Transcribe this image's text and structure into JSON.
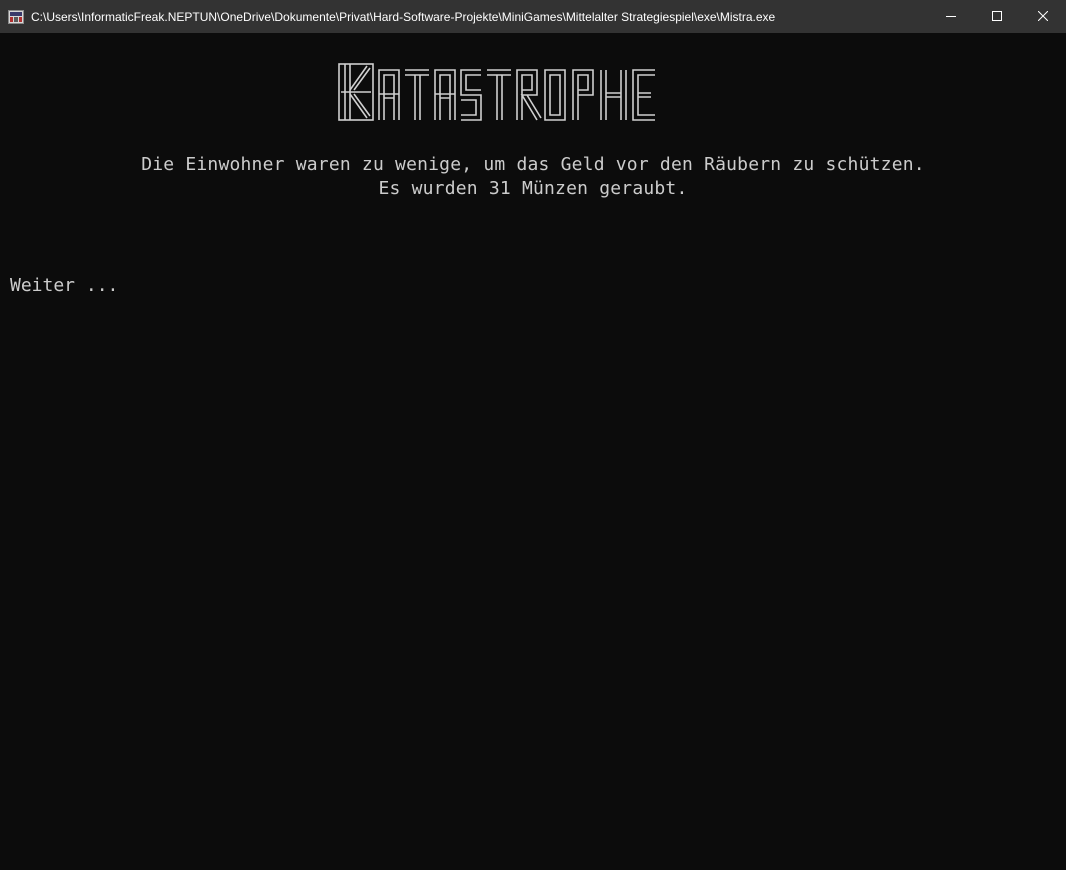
{
  "window": {
    "title": "C:\\Users\\InformaticFreak.NEPTUN\\OneDrive\\Dokumente\\Privat\\Hard-Software-Projekte\\MiniGames\\Mittelalter Strategiespiel\\exe\\Mistra.exe",
    "icon": "console-app-icon",
    "controls": [
      "minimize-icon",
      "maximize-icon",
      "close-icon"
    ]
  },
  "console": {
    "banner": "KATASTROPHE",
    "message_line_1": "Die Einwohner waren zu wenige, um das Geld vor den Räubern zu schützen.",
    "message_line_2": "Es wurden 31 Münzen geraubt.",
    "prompt": "Weiter ..."
  },
  "colors": {
    "titlebar": "#333333",
    "console_bg": "#0c0c0c",
    "console_text": "#cccccc"
  }
}
